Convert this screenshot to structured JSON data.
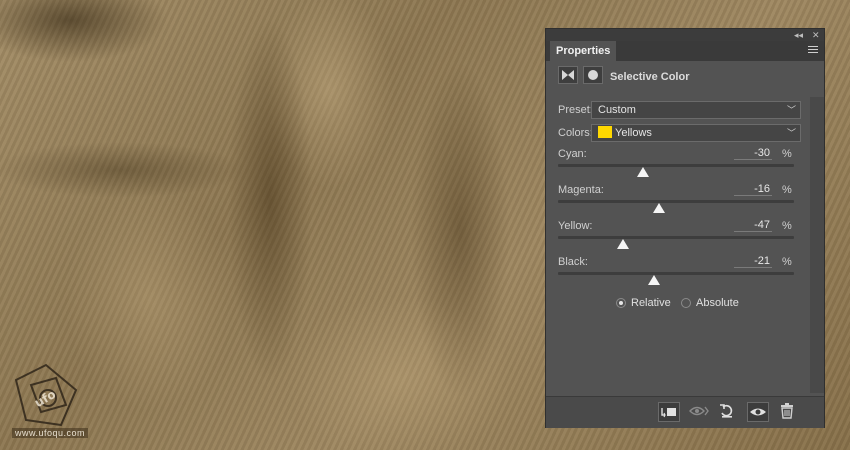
{
  "watermark": {
    "text": "www.ufoqu.com"
  },
  "panel": {
    "tab_label": "Properties",
    "title": "Selective Color",
    "preset": {
      "label": "Preset:",
      "value": "Custom"
    },
    "colors": {
      "label": "Colors:",
      "value": "Yellows",
      "swatch_color": "#ffd800"
    },
    "sliders": [
      {
        "label": "Cyan:",
        "value": "-30",
        "unit": "%"
      },
      {
        "label": "Magenta:",
        "value": "-16",
        "unit": "%"
      },
      {
        "label": "Yellow:",
        "value": "-47",
        "unit": "%"
      },
      {
        "label": "Black:",
        "value": "-21",
        "unit": "%"
      }
    ],
    "method": {
      "options": [
        "Relative",
        "Absolute"
      ],
      "selected": "Relative"
    },
    "bottom_icons": [
      "clip-to-layer-icon",
      "view-previous-state-icon",
      "reset-icon",
      "visibility-eye-icon",
      "trash-icon"
    ]
  }
}
